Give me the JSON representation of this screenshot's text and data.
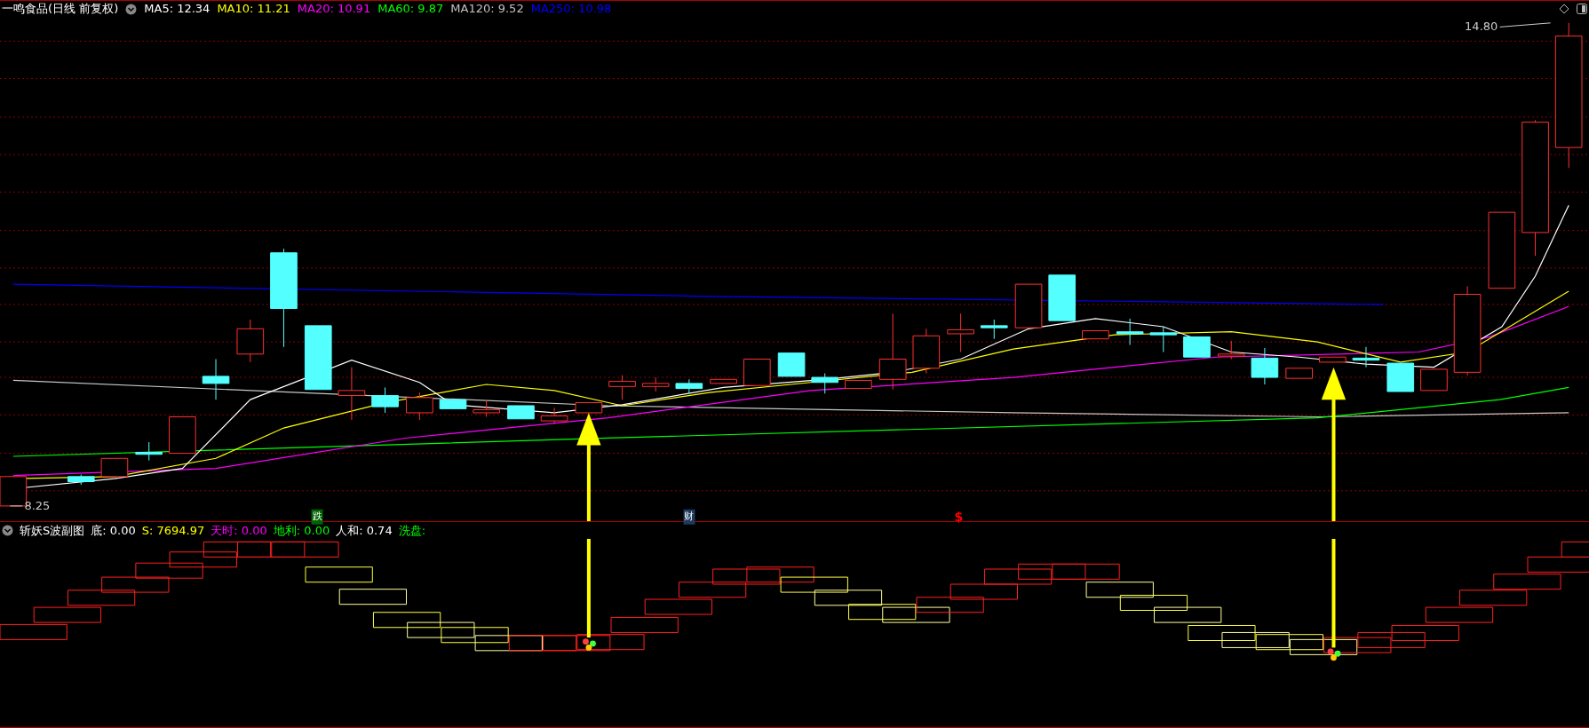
{
  "header": {
    "title": "一鸣食品(日线 前复权)",
    "ma_items": [
      {
        "text": "MA5: 12.34",
        "color": "#ffffff"
      },
      {
        "text": "MA10: 11.21",
        "color": "#ffff00"
      },
      {
        "text": "MA20: 10.91",
        "color": "#ff00ff"
      },
      {
        "text": "MA60: 9.87",
        "color": "#00ff00"
      },
      {
        "text": "MA120: 9.52",
        "color": "#c0c0c0"
      },
      {
        "text": "MA250: 10.98",
        "color": "#0000ff"
      }
    ]
  },
  "price_labels": {
    "high": "14.80",
    "low": "8.25"
  },
  "signals": [
    {
      "text": "跌",
      "kind": "box",
      "color": "#006400"
    },
    {
      "text": "财",
      "kind": "box",
      "color": "#1e3a5f"
    },
    {
      "text": "$",
      "kind": "plain",
      "color": "#ff0000"
    }
  ],
  "indicator": {
    "title": "斩妖S波副图",
    "items": [
      {
        "text": "底: 0.00",
        "color": "#ffffff"
      },
      {
        "text": "S: 7694.97",
        "color": "#ffff00"
      },
      {
        "text": "天时: 0.00",
        "color": "#ff00ff"
      },
      {
        "text": "地利: 0.00",
        "color": "#00ff00"
      },
      {
        "text": "人和: 0.74",
        "color": "#ffffff"
      },
      {
        "text": "洗盘:",
        "color": "#00ff00"
      }
    ]
  }
}
